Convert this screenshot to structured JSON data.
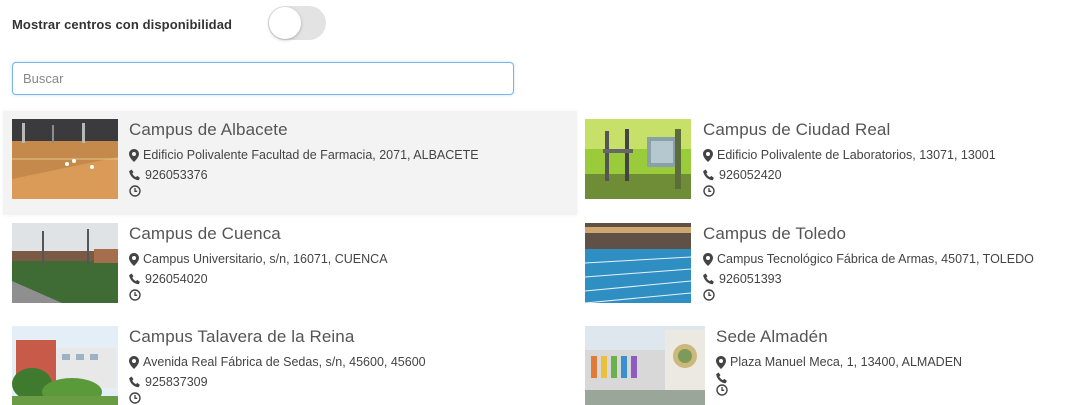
{
  "filter": {
    "label": "Mostrar centros con disponibilidad",
    "enabled": false
  },
  "search": {
    "placeholder": "Buscar",
    "value": ""
  },
  "centers": [
    {
      "name": "Campus de Albacete",
      "address": "Edificio Polivalente Facultad de Farmacia, 2071, ALBACETE",
      "phone": "926053376"
    },
    {
      "name": "Campus de Ciudad Real",
      "address": "Edificio Polivalente de Laboratorios, 13071, 13001",
      "phone": "926052420"
    },
    {
      "name": "Campus de Cuenca",
      "address": "Campus Universitario, s/n, 16071, CUENCA",
      "phone": "926054020"
    },
    {
      "name": "Campus de Toledo",
      "address": "Campus Tecnológico Fábrica de Armas, 45071, TOLEDO",
      "phone": "926051393"
    },
    {
      "name": "Campus Talavera de la Reina",
      "address": "Avenida Real Fábrica de Sedas, s/n, 45600, 45600",
      "phone": "925837309"
    },
    {
      "name": "Sede Almadén",
      "address": "Plaza Manuel Meca, 1, 13400, ALMADEN",
      "phone": ""
    }
  ],
  "icons": {
    "address": "map-marker-icon",
    "phone": "phone-icon",
    "hours": "clock-icon"
  },
  "colors": {
    "focus_border": "#79b4e6",
    "highlight_bg": "#f3f3f3",
    "toggle_off": "#e3e3e3"
  }
}
